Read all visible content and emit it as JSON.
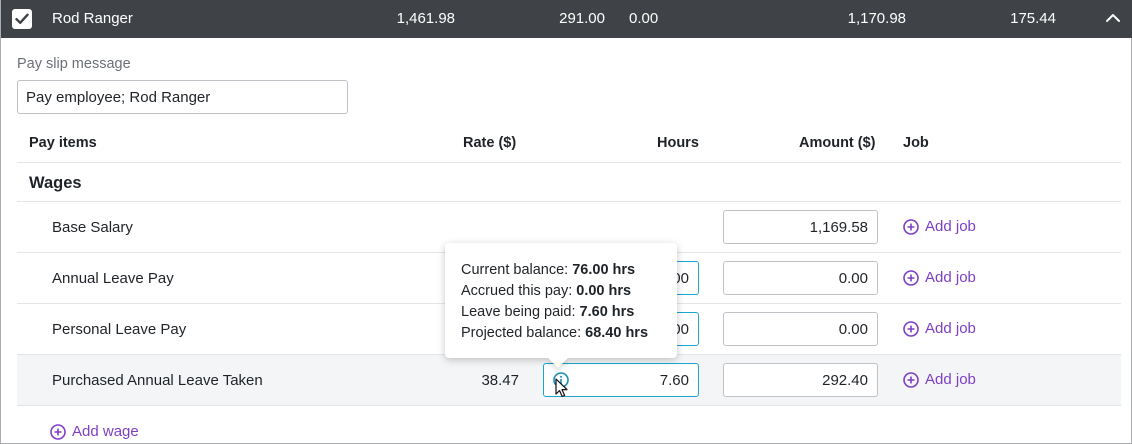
{
  "employee": {
    "name": "Rod Ranger",
    "gross": "1,461.98",
    "tax": "291.00",
    "deductions": "0.00",
    "net_pay": "1,170.98",
    "super": "175.44",
    "selected": true
  },
  "pay_slip": {
    "label": "Pay slip message",
    "value": "Pay employee; Rod Ranger"
  },
  "table": {
    "headers": {
      "pay_items": "Pay items",
      "rate": "Rate ($)",
      "hours": "Hours",
      "amount": "Amount ($)",
      "job": "Job"
    },
    "section": "Wages",
    "rows": [
      {
        "label": "Base Salary",
        "rate": "",
        "hours": "",
        "amount": "1,169.58",
        "job": "Add job"
      },
      {
        "label": "Annual Leave Pay",
        "rate": "",
        "hours": "0.00",
        "amount": "0.00",
        "job": "Add job"
      },
      {
        "label": "Personal Leave Pay",
        "rate": "",
        "hours": "0.00",
        "amount": "0.00",
        "job": "Add job"
      },
      {
        "label": "Purchased Annual Leave Taken",
        "rate": "38.47",
        "hours": "7.60",
        "amount": "292.40",
        "job": "Add job"
      }
    ],
    "add_wage": "Add wage"
  },
  "tooltip": {
    "current_label": "Current balance:",
    "current_value": "76.00 hrs",
    "accrued_label": "Accrued this pay:",
    "accrued_value": "0.00 hrs",
    "paid_label": "Leave being paid:",
    "paid_value": "7.60 hrs",
    "projected_label": "Projected balance:",
    "projected_value": "68.40 hrs"
  },
  "colors": {
    "header_bg": "#3f4246",
    "accent_purple": "#7d3fc6",
    "focus_blue": "#1ca6cf"
  }
}
